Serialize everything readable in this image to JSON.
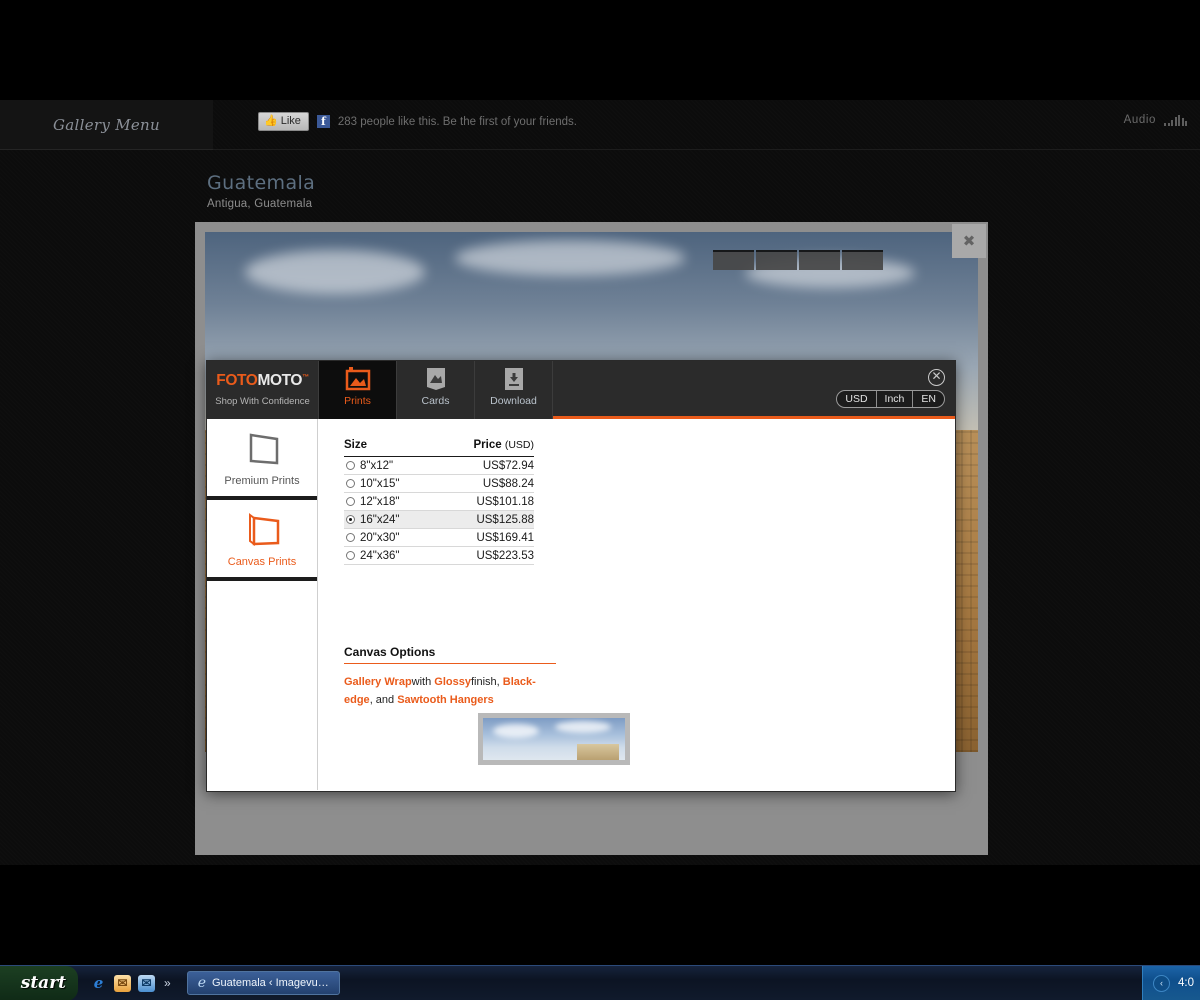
{
  "site": {
    "gallery_menu_label": "Gallery Menu",
    "facebook": {
      "like_label": "Like",
      "like_icon": "thumbs-up-icon",
      "fb_icon": "facebook-icon",
      "social_text": "283 people like this. Be the first of your friends."
    },
    "audio": {
      "label": "Audio",
      "icon": "equalizer-icon"
    },
    "title": "Guatemala",
    "subtitle": "Antigua, Guatemala",
    "viewer_close_icon": "close-icon"
  },
  "fotomoto": {
    "brand": {
      "name_orange": "FOTO",
      "name_white": "MOTO",
      "trademark": "™",
      "tagline": "Shop With Confidence"
    },
    "tabs": [
      {
        "label": "Prints",
        "icon": "framed-picture-icon",
        "active": true
      },
      {
        "label": "Cards",
        "icon": "greeting-card-icon",
        "active": false
      },
      {
        "label": "Download",
        "icon": "download-icon",
        "active": false
      }
    ],
    "options": [
      {
        "label": "USD",
        "name": "currency-option"
      },
      {
        "label": "Inch",
        "name": "units-option"
      },
      {
        "label": "EN",
        "name": "language-option"
      }
    ],
    "close_icon": "close-circle-icon",
    "sidebar": [
      {
        "label": "Premium Prints",
        "icon": "print-panel-icon",
        "active": false
      },
      {
        "label": "Canvas Prints",
        "icon": "canvas-wrap-icon",
        "active": true
      }
    ],
    "table": {
      "col_size": "Size",
      "col_price": "Price",
      "col_price_unit": "(USD)",
      "rows": [
        {
          "size": "8\"x12\"",
          "price": "US$72.94",
          "selected": false
        },
        {
          "size": "10\"x15\"",
          "price": "US$88.24",
          "selected": false
        },
        {
          "size": "12\"x18\"",
          "price": "US$101.18",
          "selected": false
        },
        {
          "size": "16\"x24\"",
          "price": "US$125.88",
          "selected": true
        },
        {
          "size": "20\"x30\"",
          "price": "US$169.41",
          "selected": false
        },
        {
          "size": "24\"x36\"",
          "price": "US$223.53",
          "selected": false
        }
      ]
    },
    "canvas_options": {
      "heading": "Canvas Options",
      "part1": "Gallery Wrap",
      "part2": "with ",
      "part3": "Glossy",
      "part4": "finish,",
      "part5": "Black-edge",
      "part6": ", and ",
      "part7": "Sawtooth Hangers"
    }
  },
  "taskbar": {
    "start_label": "start",
    "quick_launch": [
      {
        "name": "ie-quicklaunch-icon",
        "glyph": "e"
      },
      {
        "name": "mail-quicklaunch-icon",
        "glyph": "✉"
      },
      {
        "name": "outlook-quicklaunch-icon",
        "glyph": "✉"
      }
    ],
    "more_glyph": "»",
    "task_button": {
      "label": "Guatemala ‹ Imagevu…",
      "icon": "ie-icon"
    },
    "tray": {
      "chevron_glyph": "‹",
      "clock": "4:0"
    }
  },
  "colors": {
    "accent": "#ea5b1b",
    "dark": "#2b2b2b",
    "taskbar": "#16233c"
  }
}
